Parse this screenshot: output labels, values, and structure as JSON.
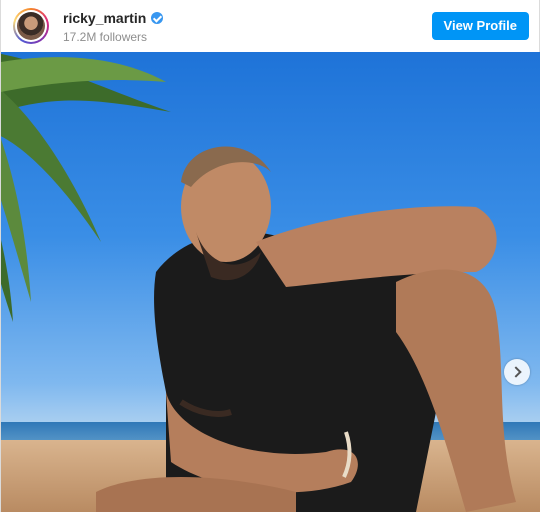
{
  "header": {
    "username": "ricky_martin",
    "verified": true,
    "followers": "17.2M followers",
    "view_profile_label": "View Profile"
  },
  "post": {
    "carousel_next_icon": "chevron-right-icon"
  },
  "colors": {
    "button": "#0095f6",
    "verified_badge": "#3897f0"
  }
}
